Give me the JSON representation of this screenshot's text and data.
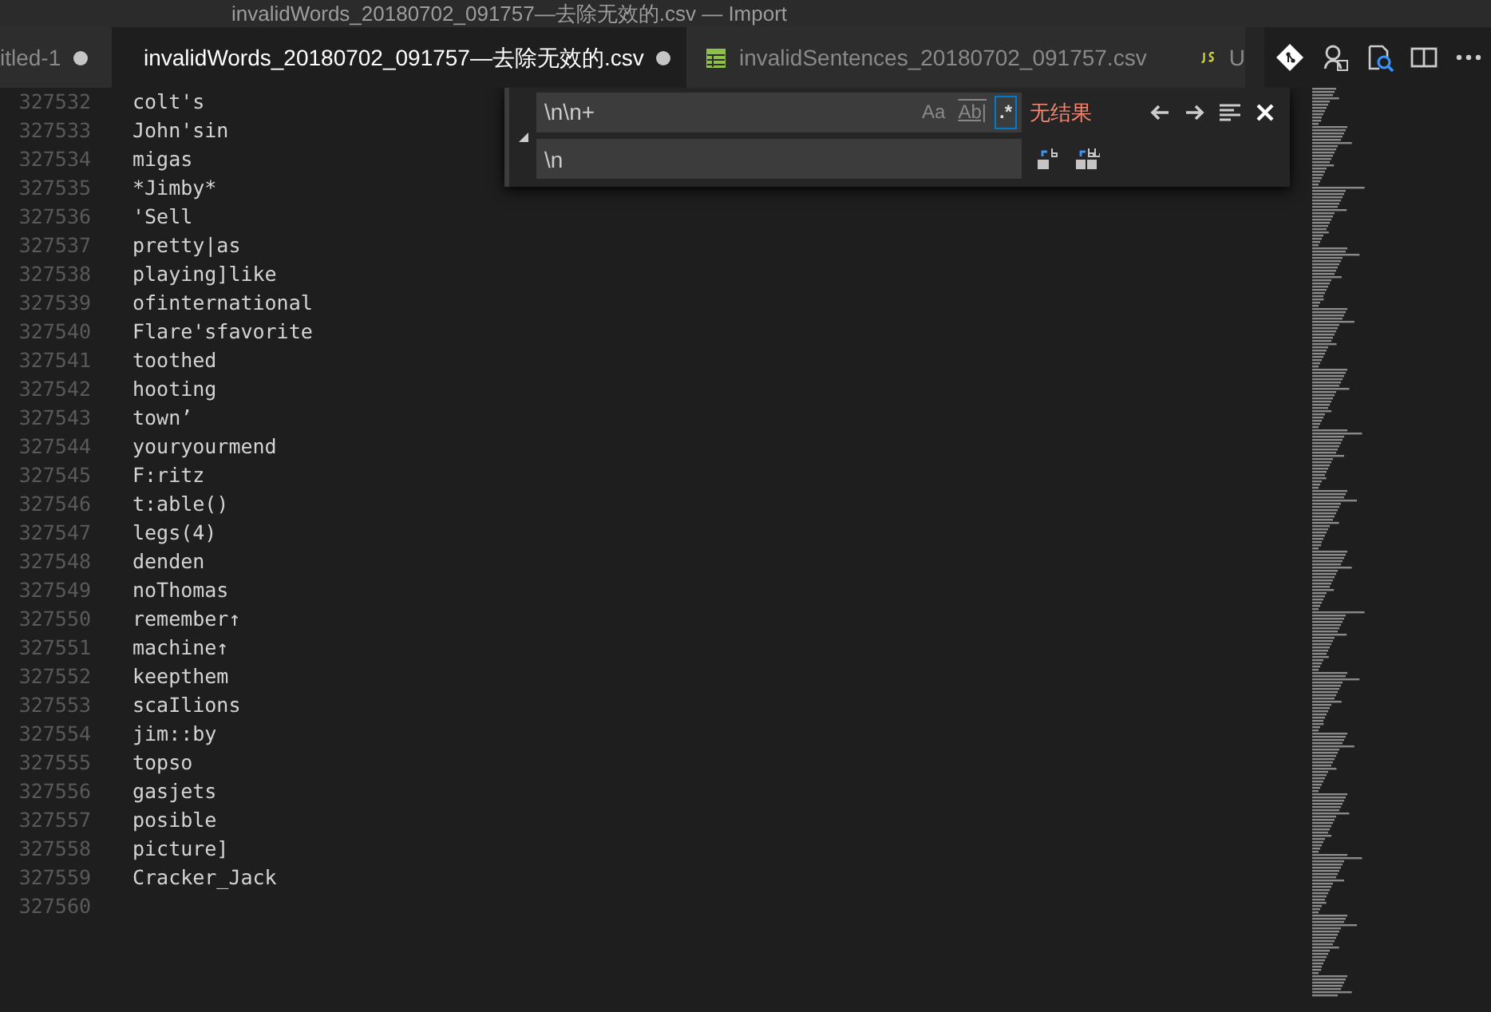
{
  "window": {
    "title": "invalidWords_20180702_091757—去除无效的.csv — Import"
  },
  "tabs": [
    {
      "label": "itled-1",
      "kind": "plain",
      "dirty": true,
      "selected": false
    },
    {
      "label": "invalidWords_20180702_091757—去除无效的.csv",
      "kind": "csv",
      "dirty": true,
      "selected": true
    },
    {
      "label": "invalidSentences_20180702_091757.csv",
      "kind": "csv",
      "dirty": false,
      "selected": false
    },
    {
      "label": "U",
      "kind": "js",
      "dirty": false,
      "selected": false
    }
  ],
  "find_widget": {
    "expanded": true,
    "find": {
      "value": "\\n\\n+"
    },
    "options": [
      {
        "kind": "match_case",
        "label": "Aa",
        "selected": false
      },
      {
        "kind": "whole_word",
        "label": "Ab|",
        "selected": false
      },
      {
        "kind": "regex",
        "label": ".*",
        "selected": true
      }
    ],
    "result": "无结果",
    "replace": {
      "value": "\\n"
    }
  },
  "lines": [
    {
      "number": "327532",
      "text": "colt's"
    },
    {
      "number": "327533",
      "text": "John'sin"
    },
    {
      "number": "327534",
      "text": "migas"
    },
    {
      "number": "327535",
      "text": "*Jimby*"
    },
    {
      "number": "327536",
      "text": "'Sell"
    },
    {
      "number": "327537",
      "text": "pretty|as"
    },
    {
      "number": "327538",
      "text": "playing]like"
    },
    {
      "number": "327539",
      "text": "ofinternational"
    },
    {
      "number": "327540",
      "text": "Flare'sfavorite"
    },
    {
      "number": "327541",
      "text": "toothed"
    },
    {
      "number": "327542",
      "text": "hooting"
    },
    {
      "number": "327543",
      "text": "town’"
    },
    {
      "number": "327544",
      "text": "youryourmend"
    },
    {
      "number": "327545",
      "text": "F:ritz"
    },
    {
      "number": "327546",
      "text": "t:able()"
    },
    {
      "number": "327547",
      "text": "legs(4)"
    },
    {
      "number": "327548",
      "text": "denden"
    },
    {
      "number": "327549",
      "text": "noThomas"
    },
    {
      "number": "327550",
      "text": "remember↑"
    },
    {
      "number": "327551",
      "text": "machine↑"
    },
    {
      "number": "327552",
      "text": "keepthem"
    },
    {
      "number": "327553",
      "text": "scaIlions"
    },
    {
      "number": "327554",
      "text": "jim::by"
    },
    {
      "number": "327555",
      "text": "topso"
    },
    {
      "number": "327556",
      "text": "gasjets"
    },
    {
      "number": "327557",
      "text": "posible"
    },
    {
      "number": "327558",
      "text": "picture]"
    },
    {
      "number": "327559",
      "text": "Cracker_Jack"
    },
    {
      "number": "327560"
    }
  ]
}
